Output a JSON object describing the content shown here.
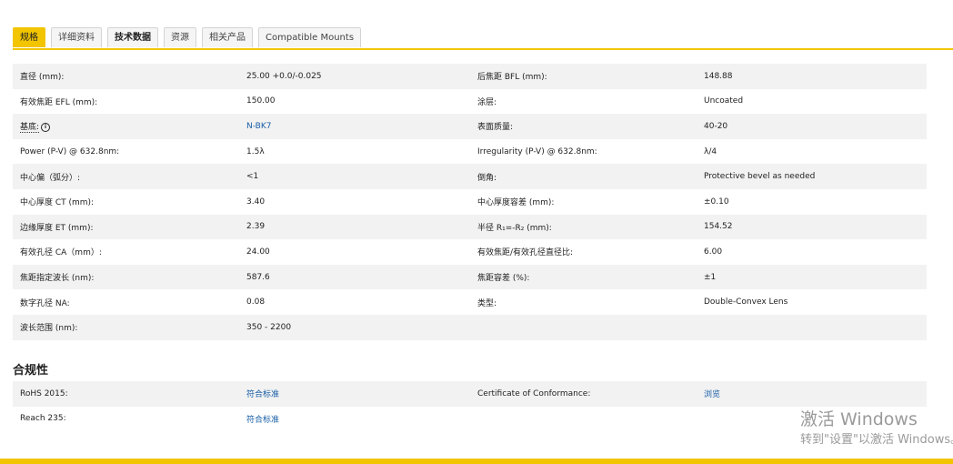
{
  "tabs": [
    {
      "label": "规格"
    },
    {
      "label": "详细资料"
    },
    {
      "label": "技术数据"
    },
    {
      "label": "资源"
    },
    {
      "label": "相关产品"
    },
    {
      "label": "Compatible Mounts"
    }
  ],
  "specs": {
    "rows": [
      {
        "l1": "直径 (mm):",
        "v1": "25.00 +0.0/-0.025",
        "l2": "后焦距 BFL (mm):",
        "v2": "148.88"
      },
      {
        "l1": "有效焦距 EFL (mm):",
        "v1": "150.00",
        "l2": "涂层:",
        "v2": "Uncoated"
      },
      {
        "l1": "基底:",
        "v1": "N-BK7",
        "l2": "表面质量:",
        "v2": "40-20"
      },
      {
        "l1": "Power (P-V) @ 632.8nm:",
        "v1": "1.5λ",
        "l2": "Irregularity (P-V) @ 632.8nm:",
        "v2": "λ/4"
      },
      {
        "l1": "中心偏（弧分）:",
        "v1": "<1",
        "l2": "倒角:",
        "v2": "Protective bevel as needed"
      },
      {
        "l1": "中心厚度 CT (mm):",
        "v1": "3.40",
        "l2": "中心厚度容差 (mm):",
        "v2": "±0.10"
      },
      {
        "l1": "边缘厚度 ET (mm):",
        "v1": "2.39",
        "l2": "半径 R₁=-R₂ (mm):",
        "v2": "154.52"
      },
      {
        "l1": "有效孔径 CA（mm）:",
        "v1": "24.00",
        "l2": "有效焦距/有效孔径直径比:",
        "v2": "6.00"
      },
      {
        "l1": "焦距指定波长 (nm):",
        "v1": "587.6",
        "l2": "焦距容差 (%):",
        "v2": "±1"
      },
      {
        "l1": "数字孔径 NA:",
        "v1": "0.08",
        "l2": "类型:",
        "v2": "Double-Convex Lens"
      },
      {
        "l1": "波长范围 (nm):",
        "v1": "350 - 2200",
        "l2": "",
        "v2": ""
      }
    ]
  },
  "compliance": {
    "title": "合规性",
    "rows": [
      {
        "l1": "RoHS 2015:",
        "v1": "符合标准",
        "l2": "Certificate of Conformance:",
        "v2": "浏览"
      },
      {
        "l1": "Reach 235:",
        "v1": "符合标准",
        "l2": "",
        "v2": ""
      }
    ]
  },
  "watermark": {
    "title": "激活 Windows",
    "subtitle": "转到\"设置\"以激活 Windows。"
  },
  "icons": {
    "info": "info-icon"
  },
  "colors": {
    "accent": "#f2c500",
    "link": "#1a5fa6",
    "row_shade": "#f2f2f2"
  }
}
